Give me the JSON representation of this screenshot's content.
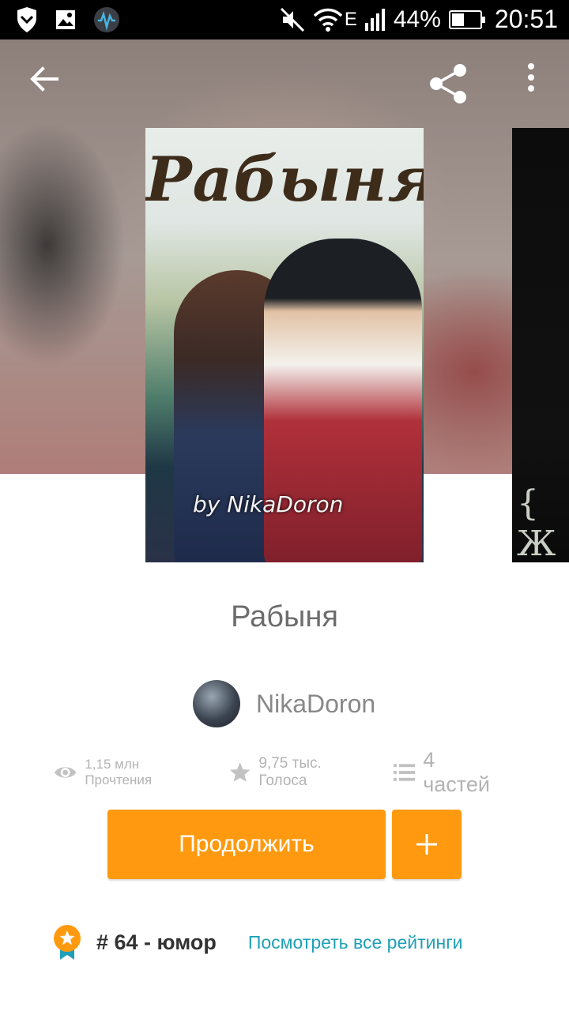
{
  "status_bar": {
    "battery_percent": "44%",
    "battery_level": 0.44,
    "time": "20:51",
    "icons": [
      "shield-icon",
      "gallery-icon",
      "audio-app-icon",
      "mute-icon",
      "wifi-icon",
      "signal-icon",
      "battery-icon"
    ],
    "network_label": "E"
  },
  "toolbar": {
    "icons": [
      "back-arrow-icon",
      "share-icon",
      "more-vert-icon"
    ]
  },
  "cover": {
    "title": "Рабыня",
    "byline": "by NikaDoron",
    "next_cover_text": "{ Ж Н"
  },
  "story": {
    "title": "Рабыня",
    "author": "NikaDoron"
  },
  "stats": {
    "reads": "1,15 млн Прочтения",
    "votes": "9,75 тыс. Голоса",
    "parts": "4 частей"
  },
  "actions": {
    "continue_label": "Продолжить",
    "add_icon": "plus-icon"
  },
  "ranking": {
    "text": "# 64 - юмор",
    "link": "Посмотреть все рейтинги"
  },
  "colors": {
    "accent": "#ff9a10",
    "link": "#1ea0b6",
    "text_muted": "#b3b3b3"
  }
}
